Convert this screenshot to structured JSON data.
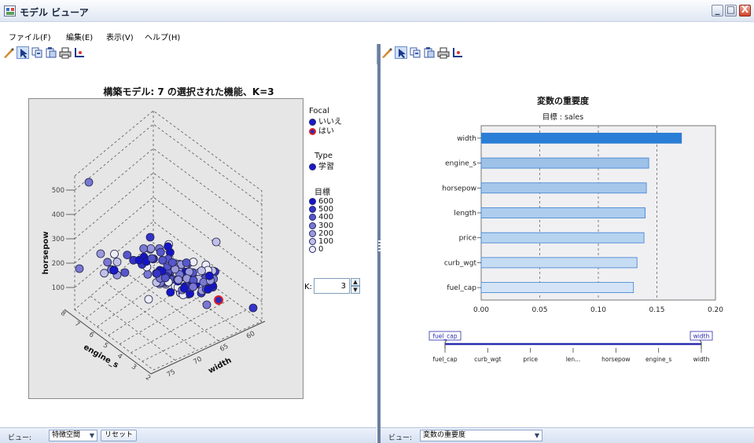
{
  "window": {
    "title": "モデル ビューア",
    "controls": {
      "minimize": "_",
      "maximize": "□",
      "close": "X"
    }
  },
  "menu": [
    {
      "label": "ファイル(F)"
    },
    {
      "label": "編集(E)"
    },
    {
      "label": "表示(V)"
    },
    {
      "label": "ヘルプ(H)"
    }
  ],
  "toolbar_icons": [
    "edit-brush-icon",
    "pointer-icon",
    "copy-icon",
    "paste-icon",
    "print-icon",
    "axis-icon"
  ],
  "left_view": {
    "title": "構築モデル: 7 の選択された機能、K=3",
    "axis_labels": {
      "vertical": "horsepow",
      "depth": "engine_s",
      "horizontal": "width"
    },
    "legend": {
      "focal": {
        "title": "Focal",
        "items": [
          {
            "label": "いいえ",
            "color": "#1a1acc",
            "ring": "#1a1acc"
          },
          {
            "label": "はい",
            "color": "#2a2ab8",
            "ring": "#e02020"
          }
        ]
      },
      "type": {
        "title": "Type",
        "items": [
          {
            "label": "学習",
            "color": "#1a1acc",
            "ring": "#1a1acc"
          }
        ]
      },
      "target": {
        "title": "目標",
        "items": [
          {
            "label": "600",
            "color": "#1414c8"
          },
          {
            "label": "500",
            "color": "#3434c9"
          },
          {
            "label": "400",
            "color": "#5656cc"
          },
          {
            "label": "300",
            "color": "#7878d2"
          },
          {
            "label": "200",
            "color": "#9a9adb"
          },
          {
            "label": "100",
            "color": "#c0c0e8"
          },
          {
            "label": "0",
            "color": "#ecedf7"
          }
        ]
      }
    },
    "k_label": "K:",
    "k_value": "3",
    "k_spin_up": "▲",
    "k_spin_down": "▼"
  },
  "left_status": {
    "view_label": "ビュー:",
    "select_value": "特徴空間",
    "reset_label": "リセット"
  },
  "right_view": {
    "title": "変数の重要度",
    "subtitle": "目標 : sales"
  },
  "right_status": {
    "view_label": "ビュー:",
    "select_value": "変数の重要度"
  },
  "chart_data": [
    {
      "type": "bar",
      "orientation": "horizontal",
      "title": "変数の重要度",
      "subtitle": "目標 : sales",
      "categories": [
        "width",
        "engine_s",
        "horsepow",
        "length",
        "price",
        "curb_wgt",
        "fuel_cap"
      ],
      "values": [
        0.171,
        0.143,
        0.141,
        0.14,
        0.139,
        0.133,
        0.13
      ],
      "xlim": [
        0,
        0.2
      ],
      "xticks": [
        "0.00",
        "0.05",
        "0.10",
        "0.15",
        "0.20"
      ],
      "bar_colors": [
        "#2a7ed6",
        "#9ec1e8",
        "#a6c7ea",
        "#aecdee",
        "#b6d3f0",
        "#c6dcf3",
        "#d4e4f6"
      ],
      "grid": "vertical dashed",
      "slider": {
        "min_label": "fuel_cap",
        "max_label": "width",
        "tick_labels": [
          "fuel_cap",
          "curb_wgt",
          "price",
          "len...",
          "horsepow",
          "engine_s",
          "width"
        ]
      }
    },
    {
      "type": "scatter",
      "projection": "3d",
      "title": "構築モデル: 7 の選択された機能、K=3",
      "zlabel": "horsepow",
      "ylabel": "engine_s",
      "xlabel": "width",
      "zticks": [
        "100",
        "200",
        "300",
        "400",
        "500"
      ],
      "yticks": [
        "2",
        "3",
        "4",
        "5",
        "6",
        "7",
        "8"
      ],
      "xticks": [
        "60",
        "65",
        "70",
        "75"
      ],
      "highlighted_focal": "はい",
      "grid": "dashed"
    }
  ]
}
